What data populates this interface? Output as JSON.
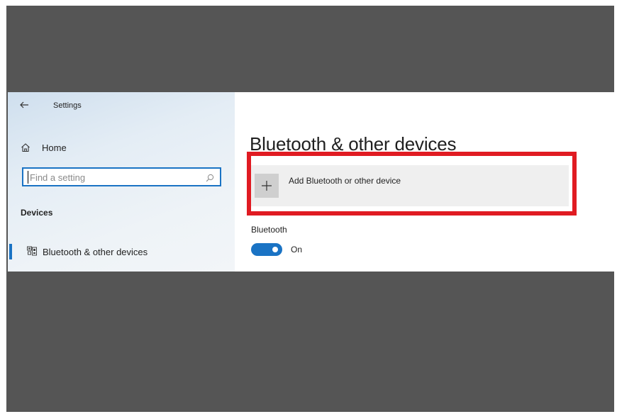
{
  "window": {
    "title": "Settings"
  },
  "sidebar": {
    "home_label": "Home",
    "search": {
      "placeholder": "Find a setting"
    },
    "section_heading": "Devices",
    "items": [
      {
        "label": "Bluetooth & other devices",
        "selected": true,
        "icon": "bluetooth-devices-icon"
      }
    ]
  },
  "main": {
    "page_title": "Bluetooth & other devices",
    "add_device": {
      "label": "Add Bluetooth or other device",
      "icon": "plus-icon"
    },
    "bluetooth": {
      "label": "Bluetooth",
      "toggle_state": "On",
      "enabled": true
    }
  },
  "colors": {
    "accent": "#1a73c4",
    "highlight": "#e01b22",
    "frame_background": "#555555"
  }
}
